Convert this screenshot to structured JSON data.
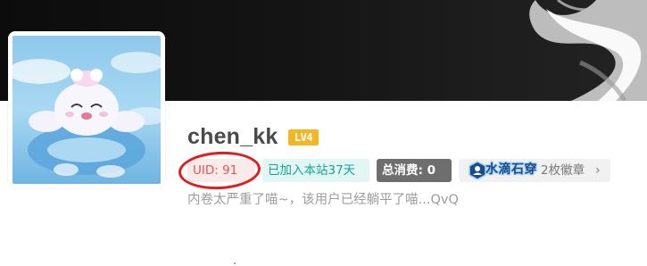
{
  "profile": {
    "username": "chen_kk",
    "level": "LV4",
    "uid": "UID: 91",
    "joined": "已加入本站37天",
    "spend": "总消费: 0",
    "badge_title": "水滴石穿",
    "badge_count": "2枚徽章",
    "bio": "内卷太严重了喵~，该用户已经躺平了喵...QvQ"
  },
  "colors": {
    "level_badge": "#f5b623",
    "uid_text": "#e0565a",
    "joined_text": "#11a892",
    "annotation": "#e21b1b"
  },
  "icons": {
    "chevron": "›",
    "badge": "hexagon-user-icon"
  }
}
